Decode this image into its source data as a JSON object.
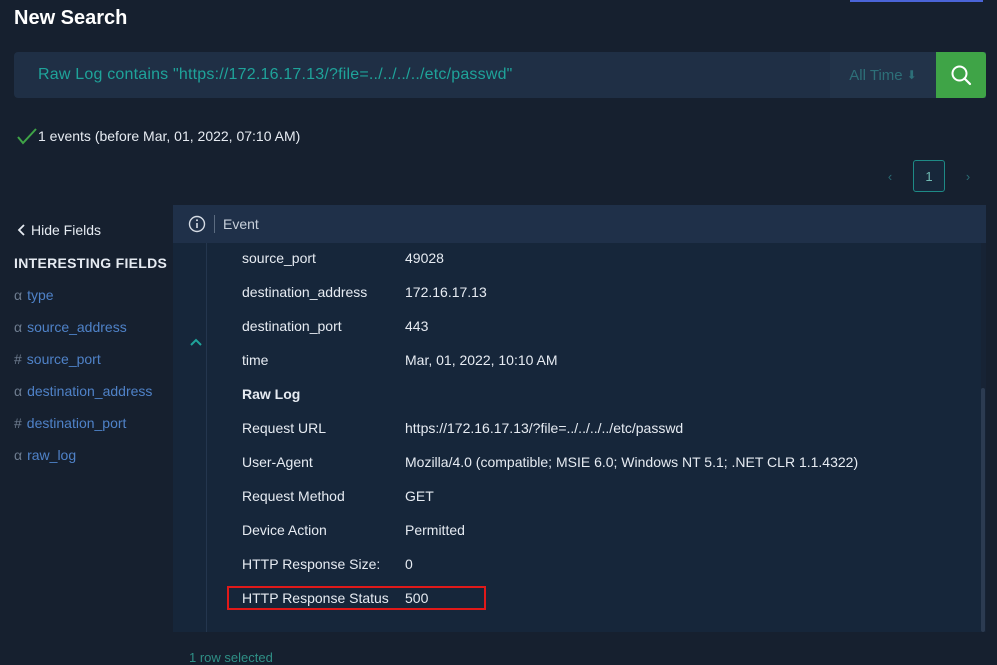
{
  "page": {
    "title": "New Search"
  },
  "search": {
    "query": "Raw Log contains \"https://172.16.17.13/?file=../../../../etc/passwd\"",
    "time_range": "All Time",
    "time_arrow": "⬇"
  },
  "results": {
    "summary": "1 events (before Mar, 01, 2022, 07:10 AM)"
  },
  "pagination": {
    "prev": "‹",
    "current": "1",
    "next": "›"
  },
  "sidebar": {
    "hide_fields_label": "Hide Fields",
    "section_title": "INTERESTING FIELDS",
    "fields": [
      {
        "type": "α",
        "name": "type"
      },
      {
        "type": "α",
        "name": "source_address"
      },
      {
        "type": "#",
        "name": "source_port"
      },
      {
        "type": "α",
        "name": "destination_address"
      },
      {
        "type": "#",
        "name": "destination_port"
      },
      {
        "type": "α",
        "name": "raw_log"
      }
    ]
  },
  "event_panel": {
    "header_label": "Event",
    "rows": [
      {
        "key": "source_port",
        "value": "49028"
      },
      {
        "key": "destination_address",
        "value": "172.16.17.13"
      },
      {
        "key": "destination_port",
        "value": "443"
      },
      {
        "key": "time",
        "value": "Mar, 01, 2022, 10:10 AM"
      },
      {
        "key": "Raw Log",
        "value": ""
      },
      {
        "key": "Request URL",
        "value": "https://172.16.17.13/?file=../../../../etc/passwd"
      },
      {
        "key": "User-Agent",
        "value": "Mozilla/4.0 (compatible; MSIE 6.0; Windows NT 5.1; .NET CLR 1.1.4322)"
      },
      {
        "key": "Request Method",
        "value": "GET"
      },
      {
        "key": "Device Action",
        "value": "Permitted"
      },
      {
        "key": "HTTP Response Size:",
        "value": "0"
      },
      {
        "key": "HTTP Response Status",
        "value": "500"
      }
    ]
  },
  "footer": {
    "selected": "1 row selected"
  },
  "colors": {
    "accent_green": "#3fa447",
    "teal_text": "#1fa39a",
    "link_blue": "#4f82c8",
    "highlight_red": "#e01919"
  }
}
